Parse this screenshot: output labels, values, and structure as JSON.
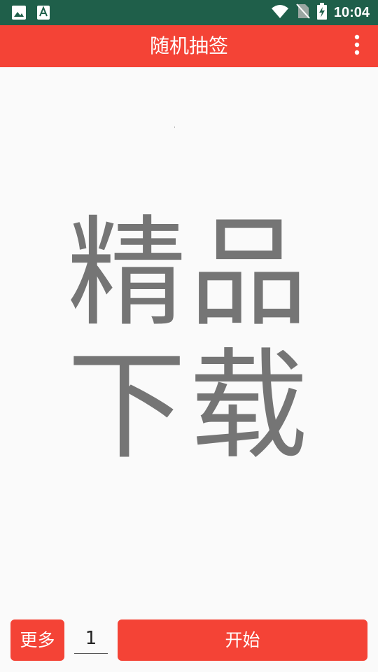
{
  "status_bar": {
    "time": "10:04",
    "icons_left": [
      "image-notification-icon",
      "app-store-notification-icon"
    ],
    "icons_right": [
      "wifi-icon",
      "no-sim-icon",
      "battery-charging-icon"
    ]
  },
  "app_bar": {
    "title": "随机抽签",
    "overflow_icon": "more-vert-icon"
  },
  "main": {
    "display_text": "精品下载"
  },
  "controls": {
    "more_label": "更多",
    "count_value": "1",
    "start_label": "开始"
  },
  "colors": {
    "primary": "#f44336",
    "status_bar": "#1f5f4a",
    "display_text": "#757575",
    "background": "#fafafa"
  }
}
